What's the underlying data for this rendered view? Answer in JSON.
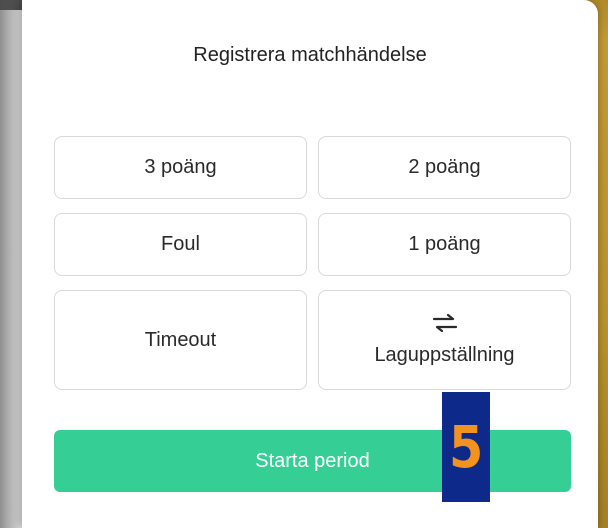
{
  "dialog": {
    "title": "Registrera matchhändelse"
  },
  "actions": {
    "three_points": "3 poäng",
    "two_points": "2 poäng",
    "foul": "Foul",
    "one_point": "1 poäng",
    "timeout": "Timeout",
    "lineup": "Laguppställning",
    "lineup_icon": "swap-arrows-icon"
  },
  "primary": {
    "start_period": "Starta period",
    "color": "#35cf95"
  },
  "overlay_badge": {
    "letter": "5",
    "background": "#0d2a8a",
    "color": "#f3931f"
  }
}
